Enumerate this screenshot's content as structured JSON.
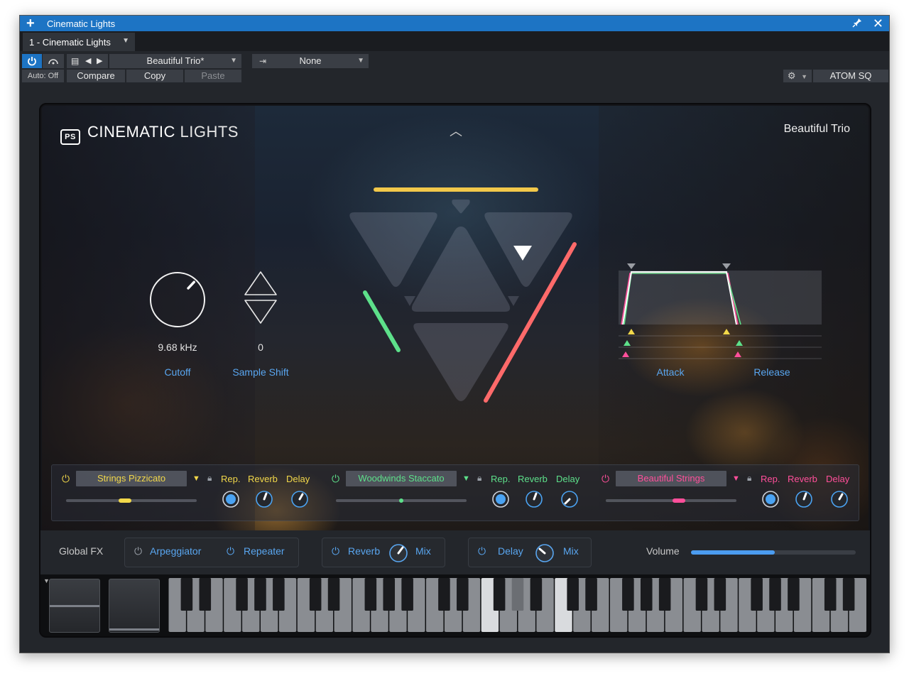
{
  "window": {
    "title": "Cinematic Lights",
    "tab": "1 - Cinematic Lights"
  },
  "toolbar": {
    "auto": "Auto: Off",
    "compare": "Compare",
    "copy": "Copy",
    "paste": "Paste",
    "preset": "Beautiful Trio*",
    "sidechain": "None",
    "controller": "ATOM SQ"
  },
  "plugin": {
    "logo_bold": "CINEMATIC",
    "logo_thin": "LIGHTS",
    "logo_mark": "PS",
    "preset_name": "Beautiful Trio",
    "cutoff_value": "9.68 kHz",
    "cutoff_label": "Cutoff",
    "cutoff_fraction": 0.66,
    "shift_value": "0",
    "shift_label": "Sample Shift",
    "attack_label": "Attack",
    "release_label": "Release"
  },
  "layers": [
    {
      "name": "Strings Pizzicato",
      "rep": "Rep.",
      "reverb": "Reverb",
      "delay": "Delay",
      "color": "#f2d84a",
      "level": 0.45
    },
    {
      "name": "Woodwinds Staccato",
      "rep": "Rep.",
      "reverb": "Reverb",
      "delay": "Delay",
      "color": "#5de08a",
      "level": 0.5
    },
    {
      "name": "Beautiful Strings",
      "rep": "Rep.",
      "reverb": "Reverb",
      "delay": "Delay",
      "color": "#ff4f9a",
      "level": 0.56
    }
  ],
  "global_fx": {
    "label": "Global FX",
    "arpeggiator": "Arpeggiator",
    "repeater": "Repeater",
    "reverb": "Reverb",
    "reverb_mix": "Mix",
    "delay": "Delay",
    "delay_mix": "Mix",
    "volume": "Volume",
    "volume_level": 0.51
  },
  "colors": {
    "accent": "#1d74c4",
    "label_blue": "#59a6f0"
  }
}
